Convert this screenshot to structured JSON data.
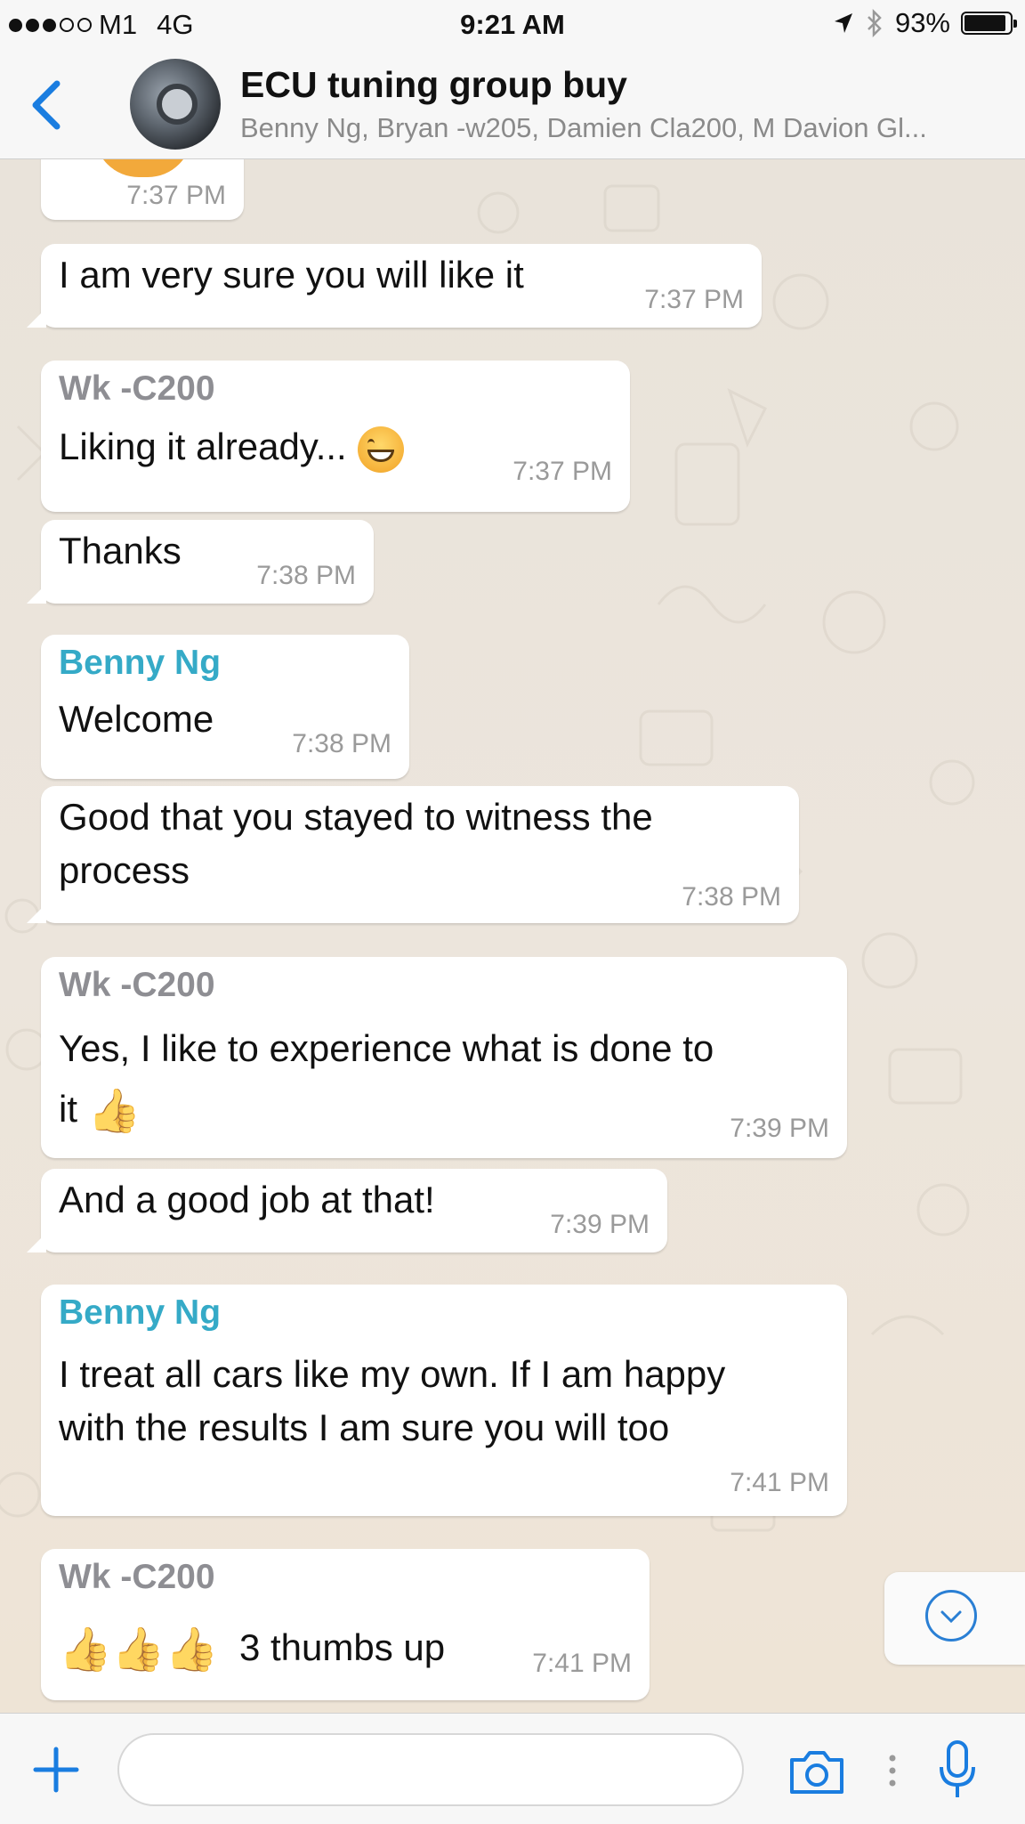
{
  "status_bar": {
    "carrier": "M1",
    "network": "4G",
    "time": "9:21 AM",
    "battery": "93%",
    "battery_level": 0.93
  },
  "header": {
    "title": "ECU tuning group buy",
    "subtitle": "Benny Ng, Bryan -w205, Damien Cla200, M Davion Gl..."
  },
  "messages": [
    {
      "time": "7:37 PM"
    },
    {
      "text": "I am very sure you will like it",
      "time": "7:37 PM"
    },
    {
      "sender": "Wk -C200",
      "text": "Liking it already...",
      "emoji": "grinning-face",
      "time": "7:37 PM"
    },
    {
      "text": "Thanks",
      "time": "7:38 PM"
    },
    {
      "sender": "Benny Ng",
      "text": "Welcome",
      "time": "7:38 PM"
    },
    {
      "text_line1": "Good that you stayed to witness the",
      "text_line2": "process",
      "time": "7:38 PM"
    },
    {
      "sender": "Wk -C200",
      "text_line1": "Yes, I like to experience what is done to",
      "text_line2": "it",
      "emoji": "thumbs-up",
      "time": "7:39 PM"
    },
    {
      "text": "And a good job at that!",
      "time": "7:39 PM"
    },
    {
      "sender": "Benny Ng",
      "text_line1": "I treat all cars like my own. If I am happy",
      "text_line2": "with the results I am sure you will too",
      "time": "7:41 PM"
    },
    {
      "sender": "Wk -C200",
      "text": "3 thumbs up",
      "emoji": "thumbs-up x3",
      "time": "7:41 PM"
    }
  ],
  "colors": {
    "sender_wk": "#8e8e93",
    "sender_benny": "#35aac7",
    "accent": "#2a7fd4"
  },
  "input": {
    "placeholder": ""
  }
}
